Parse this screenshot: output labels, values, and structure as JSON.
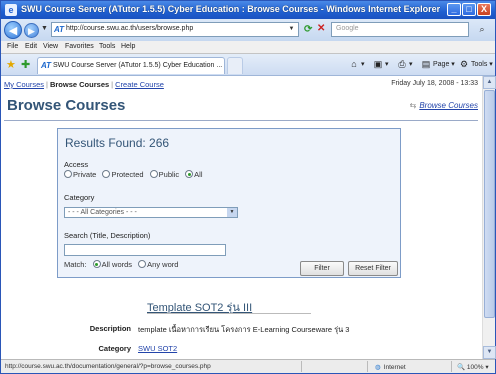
{
  "window": {
    "title": "SWU Course Server (ATutor 1.5.5) Cyber Education : Browse Courses - Windows Internet Explorer",
    "min": "_",
    "max": "□",
    "close": "X"
  },
  "address": {
    "url": "http://course.swu.ac.th/users/browse.php",
    "search_placeholder": "Google"
  },
  "menu": [
    "File",
    "Edit",
    "View",
    "Favorites",
    "Tools",
    "Help"
  ],
  "tab": {
    "title": "SWU Course Server (ATutor 1.5.5) Cyber Education ..."
  },
  "commands": {
    "page": "Page",
    "tools": "Tools"
  },
  "page": {
    "breadcrumbs": {
      "my_courses": "My Courses",
      "browse_courses": "Browse Courses",
      "create_course": "Create Course",
      "sep": "|"
    },
    "date": "Friday July 18, 2008 - 13:33",
    "heading": "Browse Courses",
    "browse_link": "Browse Courses",
    "filter": {
      "results": "Results Found: 266",
      "access_label": "Access",
      "access_options": [
        "Private",
        "Protected",
        "Public",
        "All"
      ],
      "access_selected": "All",
      "category_label": "Category",
      "category_value": "- - - All Categories - - -",
      "search_label": "Search (Title, Description)",
      "search_value": "",
      "match_label": "Match:",
      "match_options": [
        "All words",
        "Any word"
      ],
      "match_selected": "All words",
      "filter_button": "Filter",
      "reset_button": "Reset Filter"
    },
    "course": {
      "title": "Template SOT2 รุ่น III",
      "description_label": "Description",
      "description": "template เนื้อหาการเรียน โครงการ E-Learning Courseware รุ่น 3",
      "category_label": "Category",
      "category": "SWU SOT2"
    }
  },
  "status": {
    "text": "http://course.swu.ac.th/documentation/general/?p=browse_courses.php",
    "zone": "Internet",
    "zoom": "100%"
  }
}
